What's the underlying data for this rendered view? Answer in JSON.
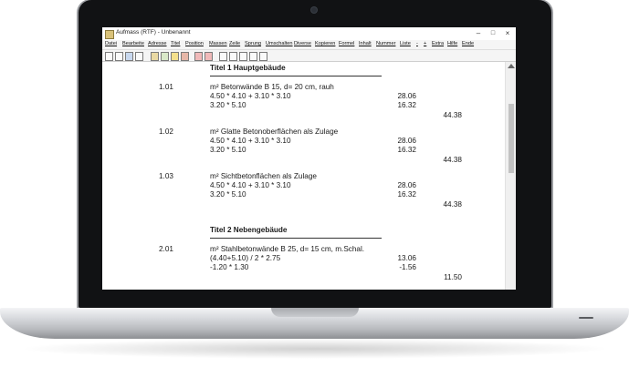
{
  "window": {
    "title": "Aufmass (RTF) - Unbenannt",
    "controls": {
      "minimize": "–",
      "maximize": "□",
      "close": "×"
    }
  },
  "menu": [
    "Datei",
    "Bearbeite",
    "Adresse",
    "Titel",
    "Position",
    "Massen",
    "Zeile",
    "Sprung",
    "Umschalten",
    "Diverse",
    "Kopieren",
    "Formel",
    "Inhalt",
    "Nummer",
    "Liste",
    "-",
    "+",
    "Extra",
    "Hilfe",
    "Ende"
  ],
  "toolbar_icons": [
    "new-icon",
    "open-icon",
    "save-icon",
    "print-icon",
    "preview-icon",
    "cut-icon",
    "copy-icon",
    "paste-icon",
    "undo-icon",
    "redo-icon",
    "calc-icon",
    "export-icon",
    "import-icon",
    "lock-icon",
    "settings-icon"
  ],
  "document": {
    "sections": [
      {
        "title": "Titel 1 Hauptgebäude"
      },
      {
        "title": "Titel 2 Nebengebäude"
      }
    ],
    "positions": [
      {
        "number": "1.01",
        "description": "m² Betonwände B 15, d= 20 cm, rauh",
        "lines": [
          {
            "formula": "4.50 * 4.10 + 3.10 * 3.10",
            "value": "28.06"
          },
          {
            "formula": "3.20 * 5.10",
            "value": "16.32"
          }
        ],
        "total": "44.38"
      },
      {
        "number": "1.02",
        "description": "m² Glatte Betonoberflächen als Zulage",
        "lines": [
          {
            "formula": "4.50 * 4.10 + 3.10 * 3.10",
            "value": "28.06"
          },
          {
            "formula": "3.20 * 5.10",
            "value": "16.32"
          }
        ],
        "total": "44.38"
      },
      {
        "number": "1.03",
        "description": "m² Sichtbetonflächen als Zulage",
        "lines": [
          {
            "formula": "4.50 * 4.10 + 3.10 * 3.10",
            "value": "28.06"
          },
          {
            "formula": "3.20 * 5.10",
            "value": "16.32"
          }
        ],
        "total": "44.38"
      },
      {
        "number": "2.01",
        "description": "m² Stahlbetonwände B 25, d= 15 cm, m.Schal.",
        "lines": [
          {
            "formula": "(4.40+5.10) / 2 * 2.75",
            "value": "13.06"
          },
          {
            "formula": "-1.20 * 1.30",
            "value": "-1.56"
          }
        ],
        "total": "11.50"
      }
    ]
  }
}
